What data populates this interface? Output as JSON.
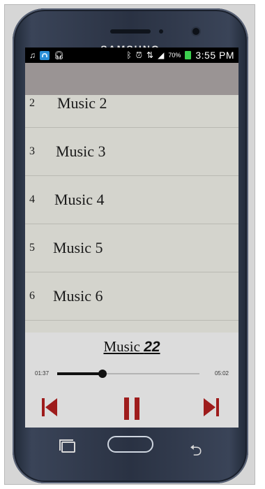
{
  "device": {
    "brand": "SAMSUNG"
  },
  "statusbar": {
    "battery_percent": "70%",
    "time": "3:55 PM"
  },
  "list": {
    "items": [
      {
        "num": "2",
        "title": "Music 2"
      },
      {
        "num": "3",
        "title": "Music 3"
      },
      {
        "num": "4",
        "title": "Music 4"
      },
      {
        "num": "5",
        "title": "Music 5"
      },
      {
        "num": "6",
        "title": "Music 6"
      }
    ]
  },
  "player": {
    "now_label": "Music",
    "now_number": "22",
    "elapsed": "01:37",
    "duration": "05:02",
    "progress": 0.32,
    "accent": "#9e1c1c"
  },
  "icons": {
    "statusbar": [
      "music-icon",
      "wifi-icon",
      "headphones-icon",
      "bluetooth-icon",
      "alarm-icon",
      "data-icon",
      "signal-icon",
      "battery-icon"
    ],
    "controls": [
      "previous-icon",
      "pause-icon",
      "next-icon"
    ],
    "navkeys": [
      "recent-apps-icon",
      "home-icon",
      "back-icon"
    ]
  }
}
